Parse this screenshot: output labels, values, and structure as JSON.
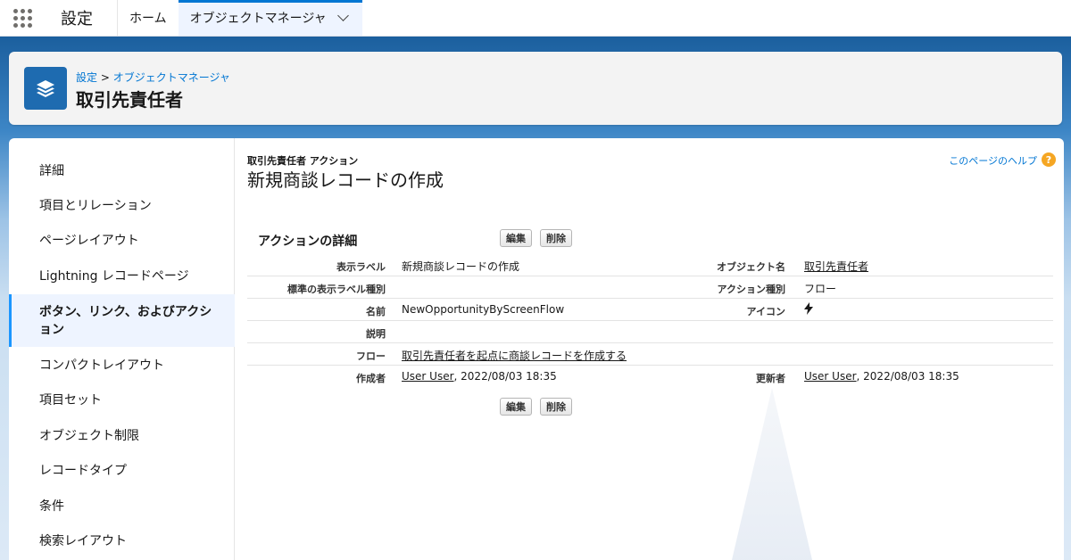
{
  "app": {
    "launcher_icon": "app-launcher-waffle-icon",
    "name": "設定"
  },
  "nav": {
    "tabs": [
      {
        "label": "ホーム"
      },
      {
        "label": "オブジェクトマネージャ"
      }
    ]
  },
  "header": {
    "breadcrumb": [
      "設定",
      ">",
      "オブジェクトマネージャ"
    ],
    "title": "取引先責任者",
    "icon": "layers-icon"
  },
  "sidebar": {
    "items": [
      {
        "label": "詳細"
      },
      {
        "label": "項目とリレーション"
      },
      {
        "label": "ページレイアウト"
      },
      {
        "label": "Lightning レコードページ"
      },
      {
        "label": "ボタン、リンク、およびアクション"
      },
      {
        "label": "コンパクトレイアウト"
      },
      {
        "label": "項目セット"
      },
      {
        "label": "オブジェクト制限"
      },
      {
        "label": "レコードタイプ"
      },
      {
        "label": "条件"
      },
      {
        "label": "検索レイアウト"
      }
    ]
  },
  "content": {
    "subtitle": "取引先責任者 アクション",
    "title": "新規商談レコードの作成",
    "help_link": "このページのヘルプ",
    "help_icon": "?",
    "section_title": "アクションの詳細",
    "edit_button": "編集",
    "delete_button": "削除",
    "details": {
      "display_label": {
        "label": "表示ラベル",
        "value": "新規商談レコードの作成"
      },
      "object_name": {
        "label": "オブジェクト名",
        "value": "取引先責任者"
      },
      "standard_label_type": {
        "label": "標準の表示ラベル種別",
        "value": ""
      },
      "action_type": {
        "label": "アクション種別",
        "value": "フロー"
      },
      "name": {
        "label": "名前",
        "value": "NewOpportunityByScreenFlow"
      },
      "icon": {
        "label": "アイコン",
        "value": "lightning-bolt-icon"
      },
      "description": {
        "label": "説明",
        "value": ""
      },
      "flow": {
        "label": "フロー",
        "value": "取引先責任者を起点に商談レコードを作成する"
      },
      "created_by": {
        "label": "作成者",
        "user": "User User",
        "date": ", 2022/08/03 18:35"
      },
      "modified_by": {
        "label": "更新者",
        "user": "User User",
        "date": ", 2022/08/03 18:35"
      }
    }
  }
}
